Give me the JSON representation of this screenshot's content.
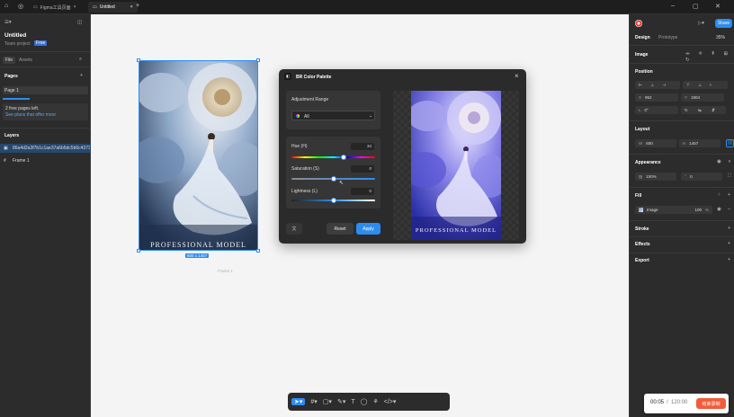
{
  "titlebar": {
    "tabs": [
      {
        "label": "Figma工具页面",
        "active": false
      },
      {
        "label": "Untitled",
        "active": true
      }
    ],
    "new_tab": "+"
  },
  "left": {
    "file_name": "Untitled",
    "team": "Team project",
    "plan_badge": "Free",
    "tabs": [
      "File",
      "Assets"
    ],
    "pages_title": "Pages",
    "page_items": [
      "Page 1"
    ],
    "free_pages_text": "2 free pages left.",
    "free_pages_link": "See plans that offer more",
    "layers_title": "Layers",
    "layers": [
      "86a4d2a3f7b1c1ae37a6b5dc5b6c4373",
      "Frame 1"
    ]
  },
  "canvas": {
    "frame_size_badge": "600 x 1457",
    "frame_label": "Frame 1",
    "image_caption": "PROFESSIONAL MODEL"
  },
  "dialog": {
    "title": "BR Color Palette",
    "adjust_range_label": "Adjustment Range",
    "range_value": "All",
    "hue_label": "Hue (H)",
    "hue_value": "34",
    "saturation_label": "Saturation (S)",
    "saturation_value": "0",
    "lightness_label": "Lightness (L)",
    "lightness_value": "0",
    "reset_label": "Reset",
    "apply_label": "Apply",
    "preview_caption": "PROFESSIONAL MODEL",
    "hue_fraction": 0.62,
    "saturation_fraction": 0.5,
    "lightness_fraction": 0.5
  },
  "right": {
    "tabs": [
      "Design",
      "Prototype"
    ],
    "zoom": "35%",
    "share_label": "Share",
    "section_image": "Image",
    "position_title": "Position",
    "x_label": "X",
    "x_value": "952",
    "y_label": "Y",
    "y_value": "1904",
    "rotation_label": "L",
    "rotation_value": "0°",
    "layout_title": "Layout",
    "w_label": "W",
    "w_value": "600",
    "h_label": "H",
    "h_value": "1457",
    "appearance_title": "Appearance",
    "opacity_value": "100%",
    "radius_value": "0",
    "fill_title": "Fill",
    "fill_name": "Image",
    "fill_opacity": "100",
    "fill_pct": "%",
    "stroke_title": "Stroke",
    "effects_title": "Effects",
    "export_title": "Export"
  },
  "timer": {
    "elapsed": "00:05",
    "separator": "/",
    "total": "120:00",
    "end_button": "结束录制"
  },
  "colors": {
    "accent": "#2d8cf0",
    "timer_button": "#f25c3a"
  }
}
